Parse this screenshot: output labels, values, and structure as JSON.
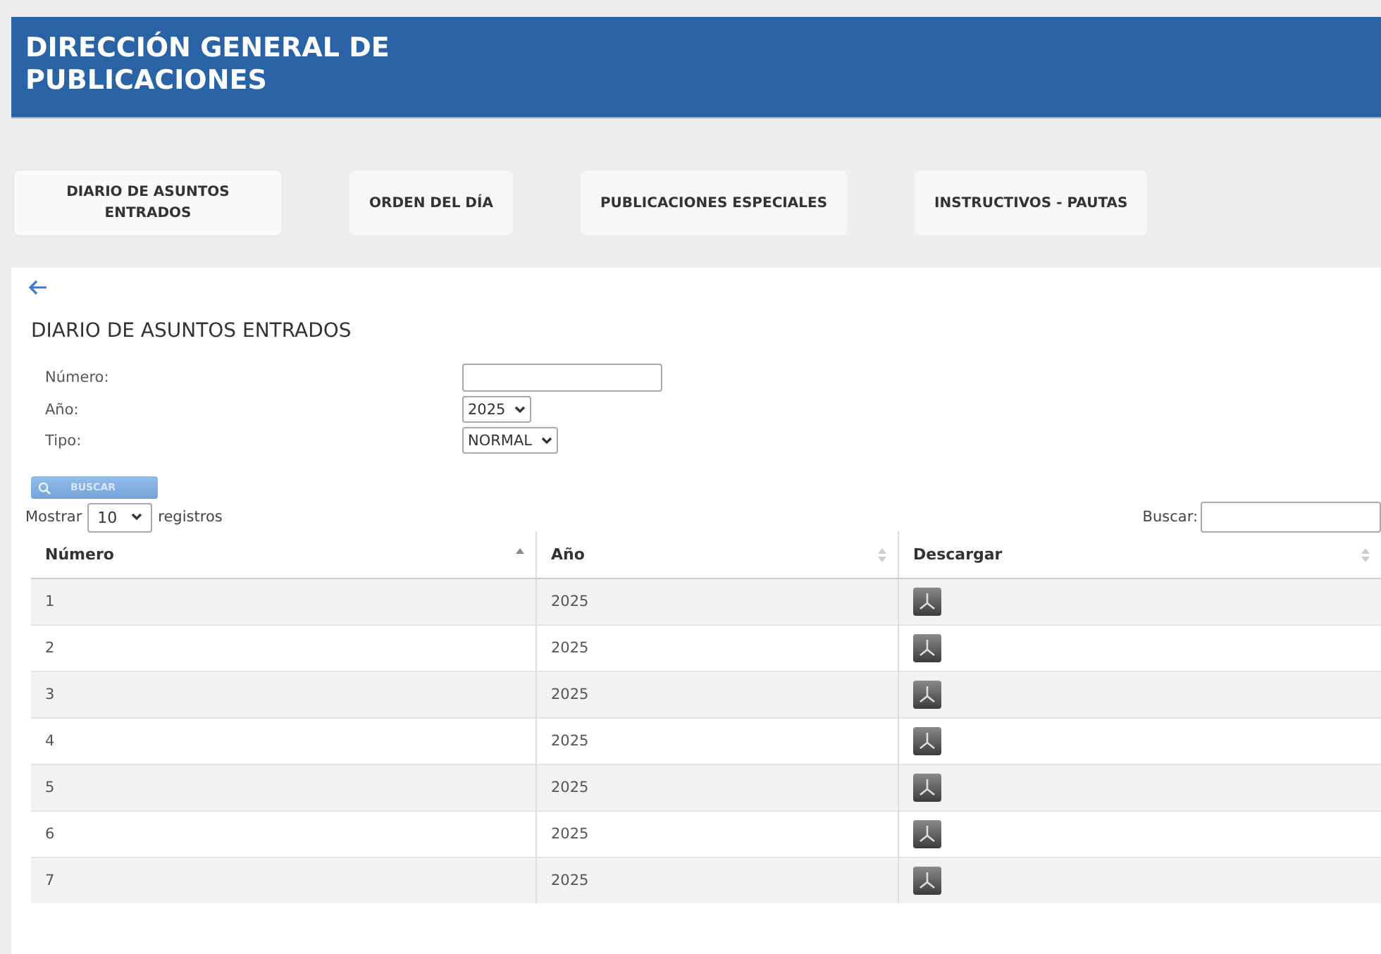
{
  "header": {
    "title": "DIRECCIÓN GENERAL DE PUBLICACIONES"
  },
  "tabs": [
    {
      "label": "DIARIO DE ASUNTOS ENTRADOS",
      "selected": true
    },
    {
      "label": "ORDEN DEL DÍA",
      "selected": false
    },
    {
      "label": "PUBLICACIONES ESPECIALES",
      "selected": false
    },
    {
      "label": "INSTRUCTIVOS - PAUTAS",
      "selected": false
    }
  ],
  "page_title": "DIARIO DE ASUNTOS ENTRADOS",
  "form": [
    {
      "kind": "text",
      "label": "Número:"
    },
    {
      "kind": "select",
      "label": "Año:",
      "value": "2025"
    },
    {
      "kind": "select",
      "label": "Tipo:",
      "value": "NORMAL"
    }
  ],
  "search_button": "BUSCAR",
  "length": {
    "prefix": "Mostrar",
    "value": "10",
    "suffix": "registros"
  },
  "filter": {
    "label": "Buscar:"
  },
  "table": {
    "columns": [
      {
        "label": "Número",
        "sorted": true
      },
      {
        "label": "Año",
        "sorted": false
      },
      {
        "label": "Descargar",
        "sorted": false
      }
    ],
    "rows": [
      {
        "numero": "1",
        "anio": "2025"
      },
      {
        "numero": "2",
        "anio": "2025"
      },
      {
        "numero": "3",
        "anio": "2025"
      },
      {
        "numero": "4",
        "anio": "2025"
      },
      {
        "numero": "5",
        "anio": "2025"
      },
      {
        "numero": "6",
        "anio": "2025"
      },
      {
        "numero": "7",
        "anio": "2025"
      }
    ]
  }
}
